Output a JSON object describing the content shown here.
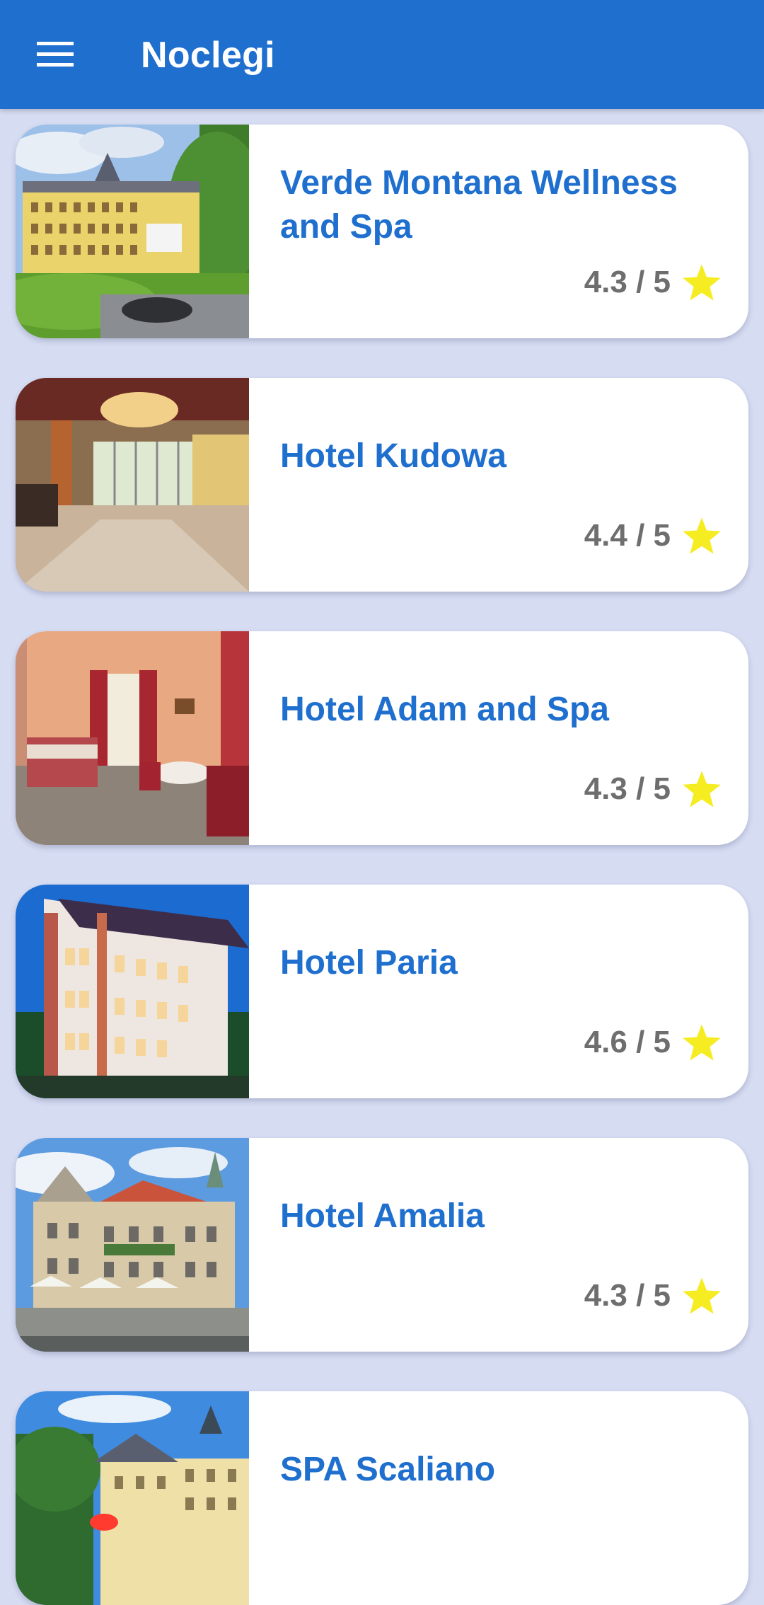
{
  "appbar": {
    "title": "Noclegi",
    "menu_icon": "hamburger-menu-icon",
    "color": "#1f6fcf"
  },
  "colors": {
    "background": "#d6dcf2",
    "name_text": "#1f6fcf",
    "rating_text": "#6e6e6e",
    "star": "#f5ec22"
  },
  "hotels": [
    {
      "name": "Verde Montana Wellness and Spa",
      "rating": "4.3 / 5",
      "star_icon": "star-icon"
    },
    {
      "name": "Hotel Kudowa",
      "rating": "4.4 / 5",
      "star_icon": "star-icon"
    },
    {
      "name": "Hotel Adam and Spa",
      "rating": "4.3 / 5",
      "star_icon": "star-icon"
    },
    {
      "name": "Hotel Paria",
      "rating": "4.6 / 5",
      "star_icon": "star-icon"
    },
    {
      "name": "Hotel Amalia",
      "rating": "4.3 / 5",
      "star_icon": "star-icon"
    },
    {
      "name": "SPA Scaliano",
      "rating": "",
      "star_icon": "star-icon"
    }
  ]
}
